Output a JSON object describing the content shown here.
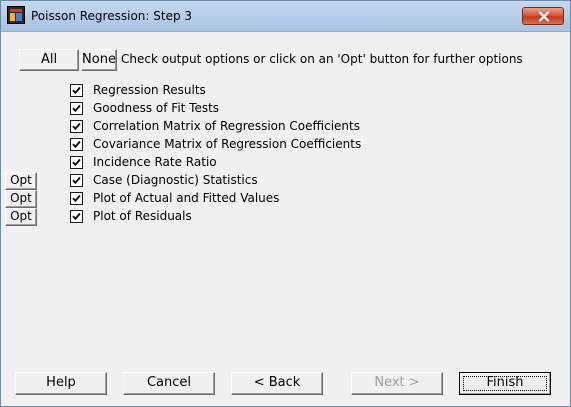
{
  "window": {
    "title": "Poisson Regression: Step 3",
    "app_icon": "statistics-app-icon",
    "close_icon": "close-icon"
  },
  "toolbar": {
    "all_label": "All",
    "none_label": "None",
    "hint": "Check output options or click on an 'Opt' button for further options"
  },
  "options": [
    {
      "label": "Regression Results",
      "checked": true,
      "has_opt": false
    },
    {
      "label": "Goodness of Fit Tests",
      "checked": true,
      "has_opt": false
    },
    {
      "label": "Correlation Matrix of Regression Coefficients",
      "checked": true,
      "has_opt": false
    },
    {
      "label": "Covariance Matrix of Regression Coefficients",
      "checked": true,
      "has_opt": false
    },
    {
      "label": "Incidence Rate Ratio",
      "checked": true,
      "has_opt": false
    },
    {
      "label": "Case (Diagnostic) Statistics",
      "checked": true,
      "has_opt": true
    },
    {
      "label": "Plot of Actual and Fitted Values",
      "checked": true,
      "has_opt": true
    },
    {
      "label": "Plot of Residuals",
      "checked": true,
      "has_opt": true
    }
  ],
  "opt_label": "Opt",
  "footer": {
    "help": "Help",
    "cancel": "Cancel",
    "back": "< Back",
    "next": "Next >",
    "finish": "Finish"
  }
}
